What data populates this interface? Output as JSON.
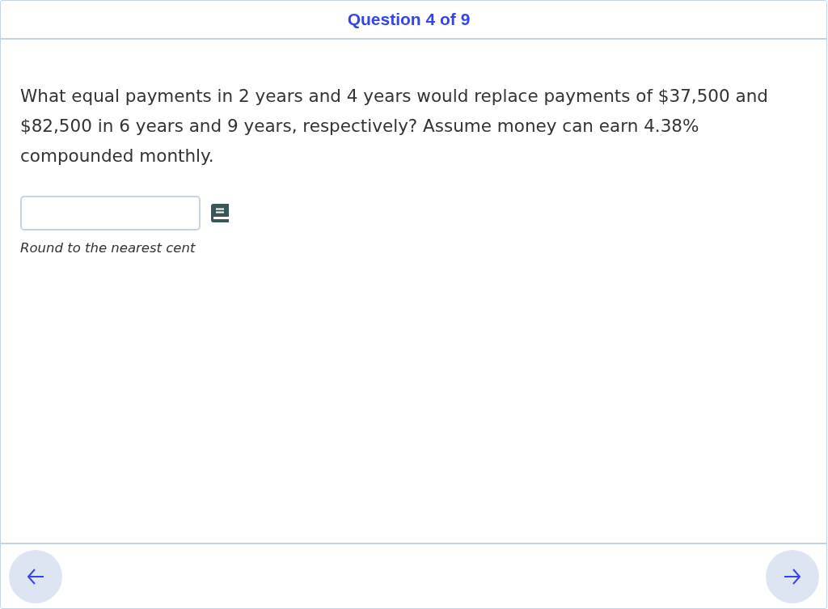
{
  "header": {
    "title": "Question 4 of 9"
  },
  "question": {
    "text": "What equal payments in 2 years and 4 years would replace payments of $37,500 and $82,500 in 6 years and 9 years, respectively? Assume money can earn 4.38% compounded monthly.",
    "hint": "Round to the nearest cent"
  }
}
